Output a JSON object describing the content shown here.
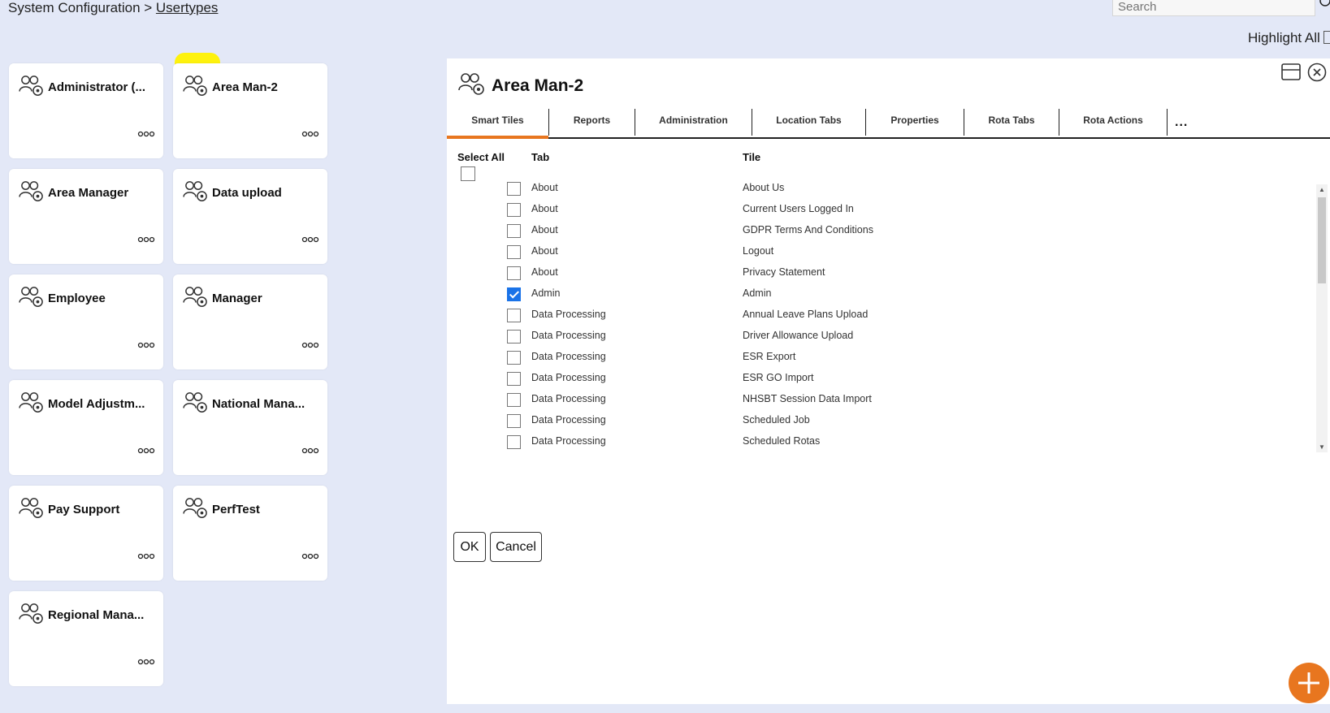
{
  "breadcrumb": {
    "root": "System Configuration",
    "separator": " > ",
    "current": "Usertypes"
  },
  "search": {
    "placeholder": "Search"
  },
  "highlight_all": {
    "label": "Highlight All"
  },
  "usertypes": [
    {
      "label": "Administrator (..."
    },
    {
      "label": "Area Man-2"
    },
    {
      "label": "Area Manager"
    },
    {
      "label": "Data upload"
    },
    {
      "label": "Employee"
    },
    {
      "label": "Manager"
    },
    {
      "label": "Model Adjustm..."
    },
    {
      "label": "National Mana..."
    },
    {
      "label": "Pay Support"
    },
    {
      "label": "PerfTest"
    },
    {
      "label": "Regional Mana..."
    }
  ],
  "panel": {
    "title": "Area Man-2",
    "tabs": [
      {
        "label": "Smart Tiles",
        "active": true
      },
      {
        "label": "Reports"
      },
      {
        "label": "Administration"
      },
      {
        "label": "Location Tabs"
      },
      {
        "label": "Properties"
      },
      {
        "label": "Rota Tabs"
      },
      {
        "label": "Rota Actions"
      }
    ],
    "more_tabs": "...",
    "columns": {
      "select_all": "Select All",
      "tab": "Tab",
      "tile": "Tile"
    },
    "rows": [
      {
        "tab": "About",
        "tile": "About Us",
        "checked": false
      },
      {
        "tab": "About",
        "tile": "Current Users Logged In",
        "checked": false
      },
      {
        "tab": "About",
        "tile": "GDPR Terms And Conditions",
        "checked": false
      },
      {
        "tab": "About",
        "tile": "Logout",
        "checked": false
      },
      {
        "tab": "About",
        "tile": "Privacy Statement",
        "checked": false
      },
      {
        "tab": "Admin",
        "tile": "Admin",
        "checked": true
      },
      {
        "tab": "Data Processing",
        "tile": "Annual Leave Plans Upload",
        "checked": false
      },
      {
        "tab": "Data Processing",
        "tile": "Driver Allowance Upload",
        "checked": false
      },
      {
        "tab": "Data Processing",
        "tile": "ESR Export",
        "checked": false
      },
      {
        "tab": "Data Processing",
        "tile": "ESR GO Import",
        "checked": false
      },
      {
        "tab": "Data Processing",
        "tile": "NHSBT Session Data Import",
        "checked": false
      },
      {
        "tab": "Data Processing",
        "tile": "Scheduled Job",
        "checked": false
      },
      {
        "tab": "Data Processing",
        "tile": "Scheduled Rotas",
        "checked": false
      }
    ],
    "ok_label": "OK",
    "cancel_label": "Cancel"
  },
  "colors": {
    "accent": "#e8761f",
    "check": "#1a73e8",
    "background": "#e3e8f7",
    "marker": "#fff200"
  }
}
